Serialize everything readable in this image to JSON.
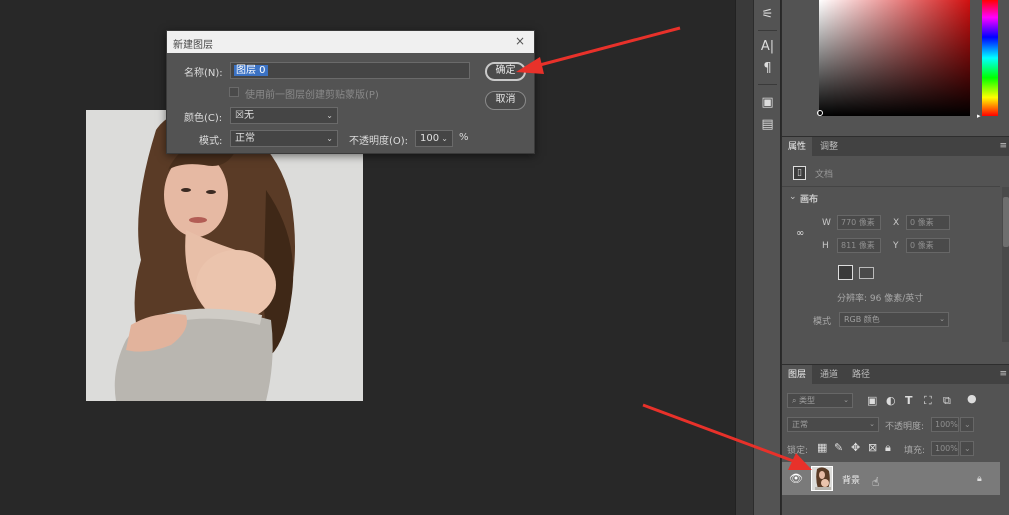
{
  "dialog": {
    "title": "新建图层",
    "close": "×",
    "name_label": "名称(N):",
    "name_value": "图层 0",
    "checkbox_label": "使用前一图层创建剪贴蒙版(P)",
    "color_label": "颜色(C):",
    "color_value": "无",
    "color_swatch": "☒",
    "mode_label": "模式:",
    "mode_value": "正常",
    "opacity_label": "不透明度(O):",
    "opacity_value": "100",
    "opacity_unit": "%",
    "ok_label": "确定",
    "cancel_label": "取消"
  },
  "properties_panel": {
    "tabs": [
      "属性",
      "调整"
    ],
    "doc_label": "文档",
    "section_title": "画布",
    "w_label": "W",
    "w_value": "770 像素",
    "x_label": "X",
    "x_value": "0 像素",
    "h_label": "H",
    "h_value": "811 像素",
    "y_label": "Y",
    "y_value": "0 像素",
    "resolution": "分辨率: 96 像素/英寸",
    "mode_label": "模式",
    "mode_value": "RGB 颜色"
  },
  "layers_panel": {
    "tabs": [
      "图层",
      "通道",
      "路径"
    ],
    "filter_value": "类型",
    "blend_value": "正常",
    "opacity_label": "不透明度:",
    "opacity_value": "100%",
    "lock_label": "锁定:",
    "fill_label": "填充:",
    "fill_value": "100%",
    "layer_name": "背景"
  },
  "colors": {
    "dialog_bg": "#535353",
    "panel_bg": "#535353",
    "canvas_bg": "#282828",
    "selection": "#3b72c4",
    "arrow": "#e8312a"
  }
}
